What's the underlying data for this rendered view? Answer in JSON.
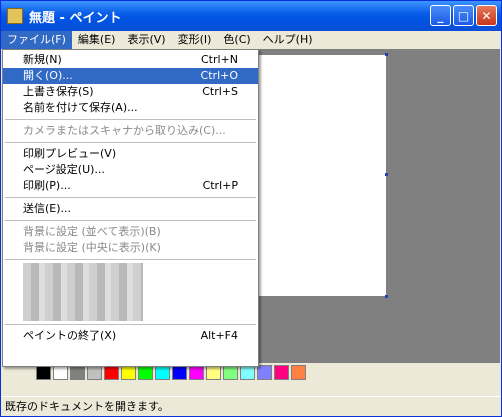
{
  "window": {
    "title": "無題 - ペイント"
  },
  "menubar": [
    {
      "label": "ファイル(F)"
    },
    {
      "label": "編集(E)"
    },
    {
      "label": "表示(V)"
    },
    {
      "label": "変形(I)"
    },
    {
      "label": "色(C)"
    },
    {
      "label": "ヘルプ(H)"
    }
  ],
  "file_menu": {
    "new": {
      "label": "新規(N)",
      "shortcut": "Ctrl+N"
    },
    "open": {
      "label": "開く(O)...",
      "shortcut": "Ctrl+O"
    },
    "save": {
      "label": "上書き保存(S)",
      "shortcut": "Ctrl+S"
    },
    "save_as": {
      "label": "名前を付けて保存(A)..."
    },
    "from_scanner": {
      "label": "カメラまたはスキャナから取り込み(C)..."
    },
    "print_preview": {
      "label": "印刷プレビュー(V)"
    },
    "page_setup": {
      "label": "ページ設定(U)..."
    },
    "print": {
      "label": "印刷(P)...",
      "shortcut": "Ctrl+P"
    },
    "send": {
      "label": "送信(E)..."
    },
    "bg_tile": {
      "label": "背景に設定 (並べて表示)(B)"
    },
    "bg_center": {
      "label": "背景に設定 (中央に表示)(K)"
    },
    "exit": {
      "label": "ペイントの終了(X)",
      "shortcut": "Alt+F4"
    }
  },
  "palette_colors": [
    "#000000",
    "#ffffff",
    "#808080",
    "#c0c0c0",
    "#ff0000",
    "#ffff00",
    "#00ff00",
    "#00ffff",
    "#0000ff",
    "#ff00ff",
    "#ffff80",
    "#80ff80",
    "#80ffff",
    "#8080ff",
    "#ff0080",
    "#ff8040"
  ],
  "status": {
    "text": "既存のドキュメントを開きます。"
  }
}
